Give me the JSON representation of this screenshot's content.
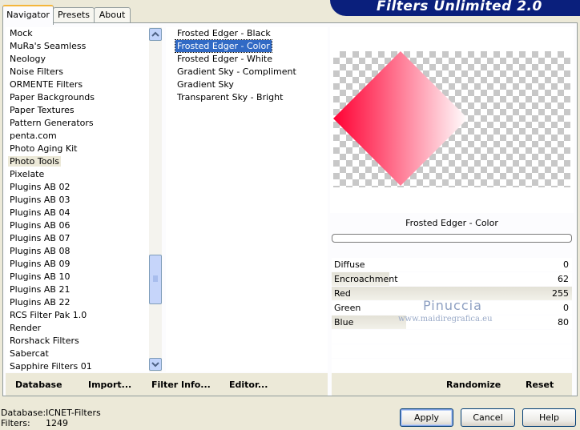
{
  "tabs": [
    {
      "label": "Navigator",
      "active": true
    },
    {
      "label": "Presets",
      "active": false
    },
    {
      "label": "About",
      "active": false
    }
  ],
  "banner": {
    "title": "Filters Unlimited 2.0",
    "color": "#0a1f7c"
  },
  "categories": {
    "items": [
      "Mock",
      "MuRa's Seamless",
      "Neology",
      "Noise Filters",
      "ORMENTE Filters",
      "Paper Backgrounds",
      "Paper Textures",
      "Pattern Generators",
      "penta.com",
      "Photo Aging Kit",
      "Photo Tools",
      "Pixelate",
      "Plugins AB 02",
      "Plugins AB 03",
      "Plugins AB 04",
      "Plugins AB 06",
      "Plugins AB 07",
      "Plugins AB 08",
      "Plugins AB 09",
      "Plugins AB 10",
      "Plugins AB 21",
      "Plugins AB 22",
      "RCS Filter Pak 1.0",
      "Render",
      "Rorshack Filters",
      "Sabercat",
      "Sapphire Filters 01"
    ],
    "selected": "Photo Tools",
    "scroll_position_fraction": 0.7
  },
  "filters": {
    "items": [
      "Frosted Edger - Black",
      "Frosted Edger - Color",
      "Frosted Edger - White",
      "Gradient Sky - Compliment",
      "Gradient Sky",
      "Transparent Sky - Bright"
    ],
    "selected": "Frosted Edger - Color"
  },
  "preview": {
    "filter_name": "Frosted Edger - Color",
    "accent_color": "#ff0033"
  },
  "parameters": [
    {
      "name": "Diffuse",
      "value": "0",
      "level": 0.0
    },
    {
      "name": "Encroachment",
      "value": "62",
      "level": 0.24
    },
    {
      "name": "Red",
      "value": "255",
      "level": 1.0
    },
    {
      "name": "Green",
      "value": "0",
      "level": 0.0
    },
    {
      "name": "Blue",
      "value": "80",
      "level": 0.31
    }
  ],
  "watermark": {
    "name": "Pinuccia",
    "site": "www.maidiregrafica.eu"
  },
  "bottom_links": {
    "database": "Database",
    "import": "Import...",
    "filter_info": "Filter Info...",
    "editor": "Editor...",
    "randomize": "Randomize",
    "reset": "Reset"
  },
  "status": {
    "database_label": "Database:",
    "database_value": "ICNET-Filters",
    "filters_label": "Filters:",
    "filters_value": "1249"
  },
  "buttons": {
    "apply": "Apply",
    "cancel": "Cancel",
    "help": "Help"
  }
}
